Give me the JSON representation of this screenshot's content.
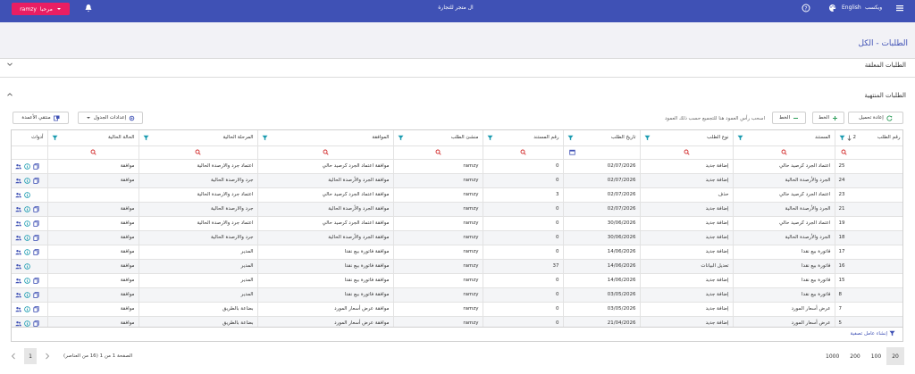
{
  "topbar": {
    "user_label": "ramzy",
    "role_label": "مرحبا",
    "brand": "ال متجر للتجارة",
    "lang": "English",
    "toggle_label": "ويكسب",
    "colors": {
      "bar": "#3f51b5",
      "user_btn": "#e91e63"
    }
  },
  "page_title": "الطلبات - الكل",
  "sections": {
    "pending": "الطلبات المعلقة",
    "finished": "الطلبات المنتهية"
  },
  "toolbar": {
    "reload": "إعادة تحميل",
    "add_line": "الخط",
    "remove_line": "الخط",
    "group_hint": "اسحب رأس العمود هنا للتجميع حسب ذلك العمود",
    "table_settings": "إعدادات الجدول",
    "column_chooser": "منتقي الأعمدة"
  },
  "columns": {
    "order_no": "رقم الطلب",
    "document": "المستند",
    "order_type": "نوع الطلب",
    "order_date": "تاريخ الطلب",
    "doc_no": "رقم المستند",
    "creator": "منشئ الطلب",
    "approval": "الموافقة",
    "stage": "المرحلة الحالية",
    "status": "الحالة الحالية",
    "tools": "أدوات",
    "sort_index": "2"
  },
  "rows": [
    {
      "no": "25",
      "doc": "اعتماد الجرد كرصيد حالي",
      "type": "إضافة جديد",
      "date": "02/07/2026",
      "docno": "0",
      "creator": "ramzy",
      "approval": "موافقة اعتماد الجرد كرصيد حالي",
      "stage": "اعتماد جرد والارصدة الحالية",
      "status": "موافقة",
      "tools": 3
    },
    {
      "no": "24",
      "doc": "الجرد والأرصدة الحالية",
      "type": "إضافة جديد",
      "date": "02/07/2026",
      "docno": "0",
      "creator": "ramzy",
      "approval": "موافقة الجرد والأرصدة الحالية",
      "stage": "جرد والارصدة الحالية",
      "status": "موافقة",
      "tools": 3
    },
    {
      "no": "23",
      "doc": "اعتماد الجرد كرصيد حالي",
      "type": "حذف",
      "date": "02/07/2026",
      "docno": "3",
      "creator": "ramzy",
      "approval": "موافقة اعتماد الجرد كرصيد حالي",
      "stage": "اعتماد جرد والارصدة الحالية",
      "status": "",
      "tools": 2
    },
    {
      "no": "21",
      "doc": "الجرد والأرصدة الحالية",
      "type": "إضافة جديد",
      "date": "02/07/2026",
      "docno": "0",
      "creator": "ramzy",
      "approval": "موافقة الجرد والأرصدة الحالية",
      "stage": "جرد والارصدة الحالية",
      "status": "موافقة",
      "tools": 3
    },
    {
      "no": "19",
      "doc": "اعتماد الجرد كرصيد حالي",
      "type": "إضافة جديد",
      "date": "30/06/2026",
      "docno": "0",
      "creator": "ramzy",
      "approval": "موافقة اعتماد الجرد كرصيد حالي",
      "stage": "اعتماد جرد والارصدة الحالية",
      "status": "موافقة",
      "tools": 3
    },
    {
      "no": "18",
      "doc": "الجرد والأرصدة الحالية",
      "type": "إضافة جديد",
      "date": "30/06/2026",
      "docno": "0",
      "creator": "ramzy",
      "approval": "موافقة الجرد والأرصدة الحالية",
      "stage": "جرد والارصدة الحالية",
      "status": "موافقة",
      "tools": 3
    },
    {
      "no": "17",
      "doc": "فاتورة بيع نقدا",
      "type": "إضافة جديد",
      "date": "14/06/2026",
      "docno": "0",
      "creator": "ramzy",
      "approval": "موافقة فاتورة بيع نقدا",
      "stage": "المدير",
      "status": "موافقة",
      "tools": 3
    },
    {
      "no": "16",
      "doc": "فاتورة بيع نقدا",
      "type": "تعديل البيانات",
      "date": "14/06/2026",
      "docno": "37",
      "creator": "ramzy",
      "approval": "موافقة فاتورة بيع نقدا",
      "stage": "المدير",
      "status": "موافقة",
      "tools": 2
    },
    {
      "no": "15",
      "doc": "فاتورة بيع نقدا",
      "type": "إضافة جديد",
      "date": "14/06/2026",
      "docno": "0",
      "creator": "ramzy",
      "approval": "موافقة فاتورة بيع نقدا",
      "stage": "المدير",
      "status": "موافقة",
      "tools": 3
    },
    {
      "no": "8",
      "doc": "فاتورة بيع نقدا",
      "type": "إضافة جديد",
      "date": "03/05/2026",
      "docno": "0",
      "creator": "ramzy",
      "approval": "موافقة فاتورة بيع نقدا",
      "stage": "المدير",
      "status": "موافقة",
      "tools": 3
    },
    {
      "no": "7",
      "doc": "عرض أسعار المورد",
      "type": "إضافة جديد",
      "date": "03/05/2026",
      "docno": "0",
      "creator": "ramzy",
      "approval": "موافقة عرض أسعار المورد",
      "stage": "بضاعة بالطريق",
      "status": "موافقة",
      "tools": 3
    },
    {
      "no": "5",
      "doc": "عرض أسعار المورد",
      "type": "إضافة جديد",
      "date": "21/04/2026",
      "docno": "0",
      "creator": "ramzy",
      "approval": "موافقة عرض أسعار المورد",
      "stage": "بضاعة بالطريق",
      "status": "موافقة",
      "tools": 3
    }
  ],
  "grid_footer": {
    "clear_filter": "إنشاء عامل تصفية"
  },
  "pager": {
    "current_page": "1",
    "info": "الصفحة 1 من 1 (16 من العناصر)",
    "sizes": [
      "1000",
      "200",
      "100",
      "20"
    ],
    "selected_size": "20"
  }
}
